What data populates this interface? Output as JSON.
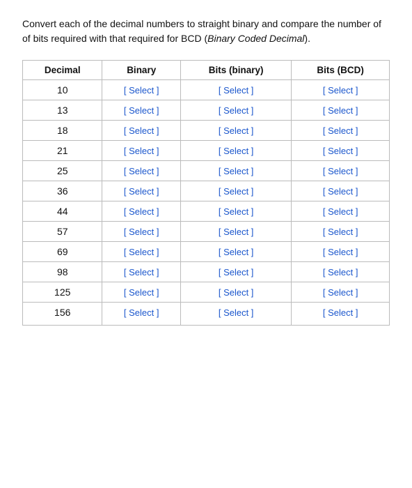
{
  "instructions": {
    "text": "Convert each of the decimal numbers to straight binary and compare the number of of bits required with that required for BCD (",
    "italic": "Binary Coded Decimal",
    "text_end": ")."
  },
  "table": {
    "headers": [
      "Decimal",
      "Binary",
      "Bits (binary)",
      "Bits (BCD)"
    ],
    "select_label": "[ Select ]",
    "rows": [
      {
        "decimal": "10"
      },
      {
        "decimal": "13"
      },
      {
        "decimal": "18"
      },
      {
        "decimal": "21"
      },
      {
        "decimal": "25"
      },
      {
        "decimal": "36"
      },
      {
        "decimal": "44"
      },
      {
        "decimal": "57"
      },
      {
        "decimal": "69"
      },
      {
        "decimal": "98"
      },
      {
        "decimal": "125"
      },
      {
        "decimal": "156"
      }
    ]
  }
}
